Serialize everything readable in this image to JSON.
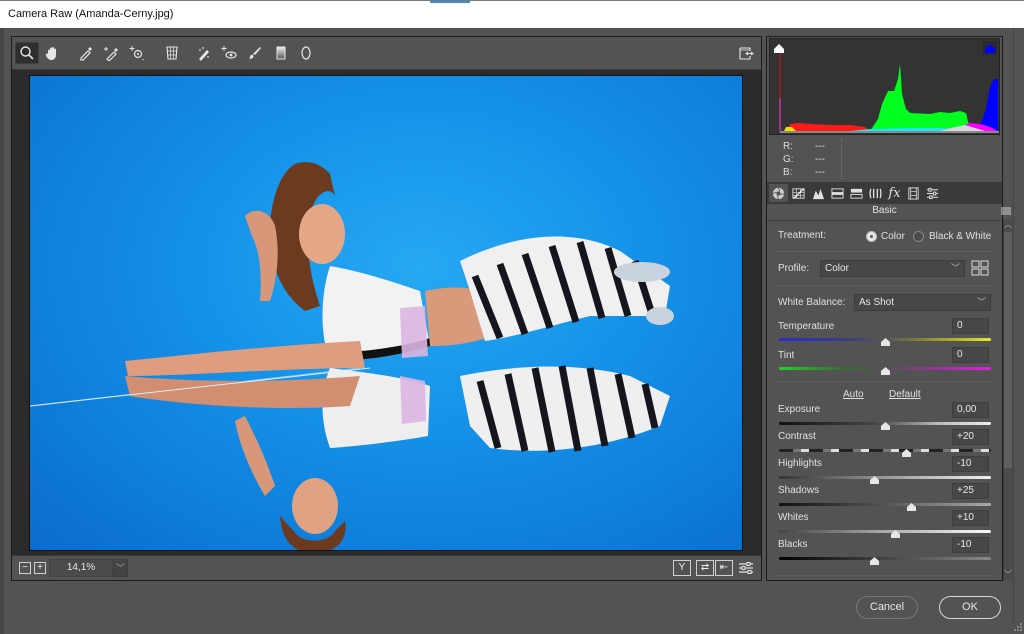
{
  "window": {
    "title": "Camera Raw (Amanda-Cerny.jpg)"
  },
  "toolbar": {
    "tools": [
      {
        "name": "zoom-tool",
        "icon": "magnifier-icon",
        "active": true
      },
      {
        "name": "hand-tool",
        "icon": "hand-icon"
      },
      {
        "name": "white-balance-tool",
        "icon": "eyedropper-icon"
      },
      {
        "name": "color-sampler-tool",
        "icon": "sampler-eyedropper-icon"
      },
      {
        "name": "targeted-adjustment-tool",
        "icon": "target-adjust-icon"
      },
      {
        "name": "transform-tool",
        "icon": "transform-grid-icon"
      },
      {
        "name": "spot-removal-tool",
        "icon": "spot-heal-icon"
      },
      {
        "name": "red-eye-tool",
        "icon": "red-eye-icon"
      },
      {
        "name": "adjustment-brush-tool",
        "icon": "brush-icon"
      },
      {
        "name": "graduated-filter-tool",
        "icon": "gradient-icon"
      },
      {
        "name": "radial-filter-tool",
        "icon": "ellipse-icon"
      }
    ],
    "fullscreen_toggle": "toggle-fullscreen-icon"
  },
  "statusbar": {
    "zoom_out": "−",
    "zoom_in": "+",
    "zoom_level": "14,1%",
    "view_buttons": [
      {
        "name": "before-after-view",
        "label": "Y"
      },
      {
        "name": "swap-before-after",
        "label": "⇄"
      },
      {
        "name": "copy-after-to-before",
        "label": "⇤"
      }
    ],
    "preview_prefs": "preview-settings-icon"
  },
  "histogram": {
    "readout": [
      {
        "label": "R:",
        "value": "---"
      },
      {
        "label": "G:",
        "value": "---"
      },
      {
        "label": "B:",
        "value": "---"
      }
    ],
    "colors": {
      "shadow_clip": "#ffffff",
      "highlight_clip": "#0000ff",
      "red": "#ff1a1a",
      "green": "#00ff1e",
      "blue": "#0000ff",
      "magenta": "#ff00ff"
    }
  },
  "panel_tabs": [
    {
      "name": "basic",
      "icon": "aperture-icon",
      "active": true
    },
    {
      "name": "tone-curve",
      "icon": "curve-grid-icon"
    },
    {
      "name": "detail",
      "icon": "mountains-icon"
    },
    {
      "name": "hsl",
      "icon": "hsl-bars-icon"
    },
    {
      "name": "split-toning",
      "icon": "split-tone-icon"
    },
    {
      "name": "lens-corrections",
      "icon": "lens-icon"
    },
    {
      "name": "effects",
      "icon": "fx-icon"
    },
    {
      "name": "calibration",
      "icon": "film-icon"
    },
    {
      "name": "presets",
      "icon": "sliders-icon"
    }
  ],
  "basic": {
    "title": "Basic",
    "treatment": {
      "label": "Treatment:",
      "options": [
        "Color",
        "Black & White"
      ],
      "selected": "Color"
    },
    "profile": {
      "label": "Profile:",
      "value": "Color"
    },
    "white_balance": {
      "label": "White Balance:",
      "value": "As Shot"
    },
    "temperature": {
      "label": "Temperature",
      "value": "0",
      "position": 0.5
    },
    "tint": {
      "label": "Tint",
      "value": "0",
      "position": 0.5
    },
    "auto_label": "Auto",
    "default_label": "Default",
    "sliders": [
      {
        "name": "exposure",
        "label": "Exposure",
        "value": "0,00",
        "position": 0.5
      },
      {
        "name": "contrast",
        "label": "Contrast",
        "value": "+20",
        "position": 0.6
      },
      {
        "name": "highlights",
        "label": "Highlights",
        "value": "-10",
        "position": 0.45
      },
      {
        "name": "shadows",
        "label": "Shadows",
        "value": "+25",
        "position": 0.625
      },
      {
        "name": "whites",
        "label": "Whites",
        "value": "+10",
        "position": 0.55
      },
      {
        "name": "blacks",
        "label": "Blacks",
        "value": "-10",
        "position": 0.45
      }
    ]
  },
  "footer": {
    "cancel_label": "Cancel",
    "ok_label": "OK"
  }
}
